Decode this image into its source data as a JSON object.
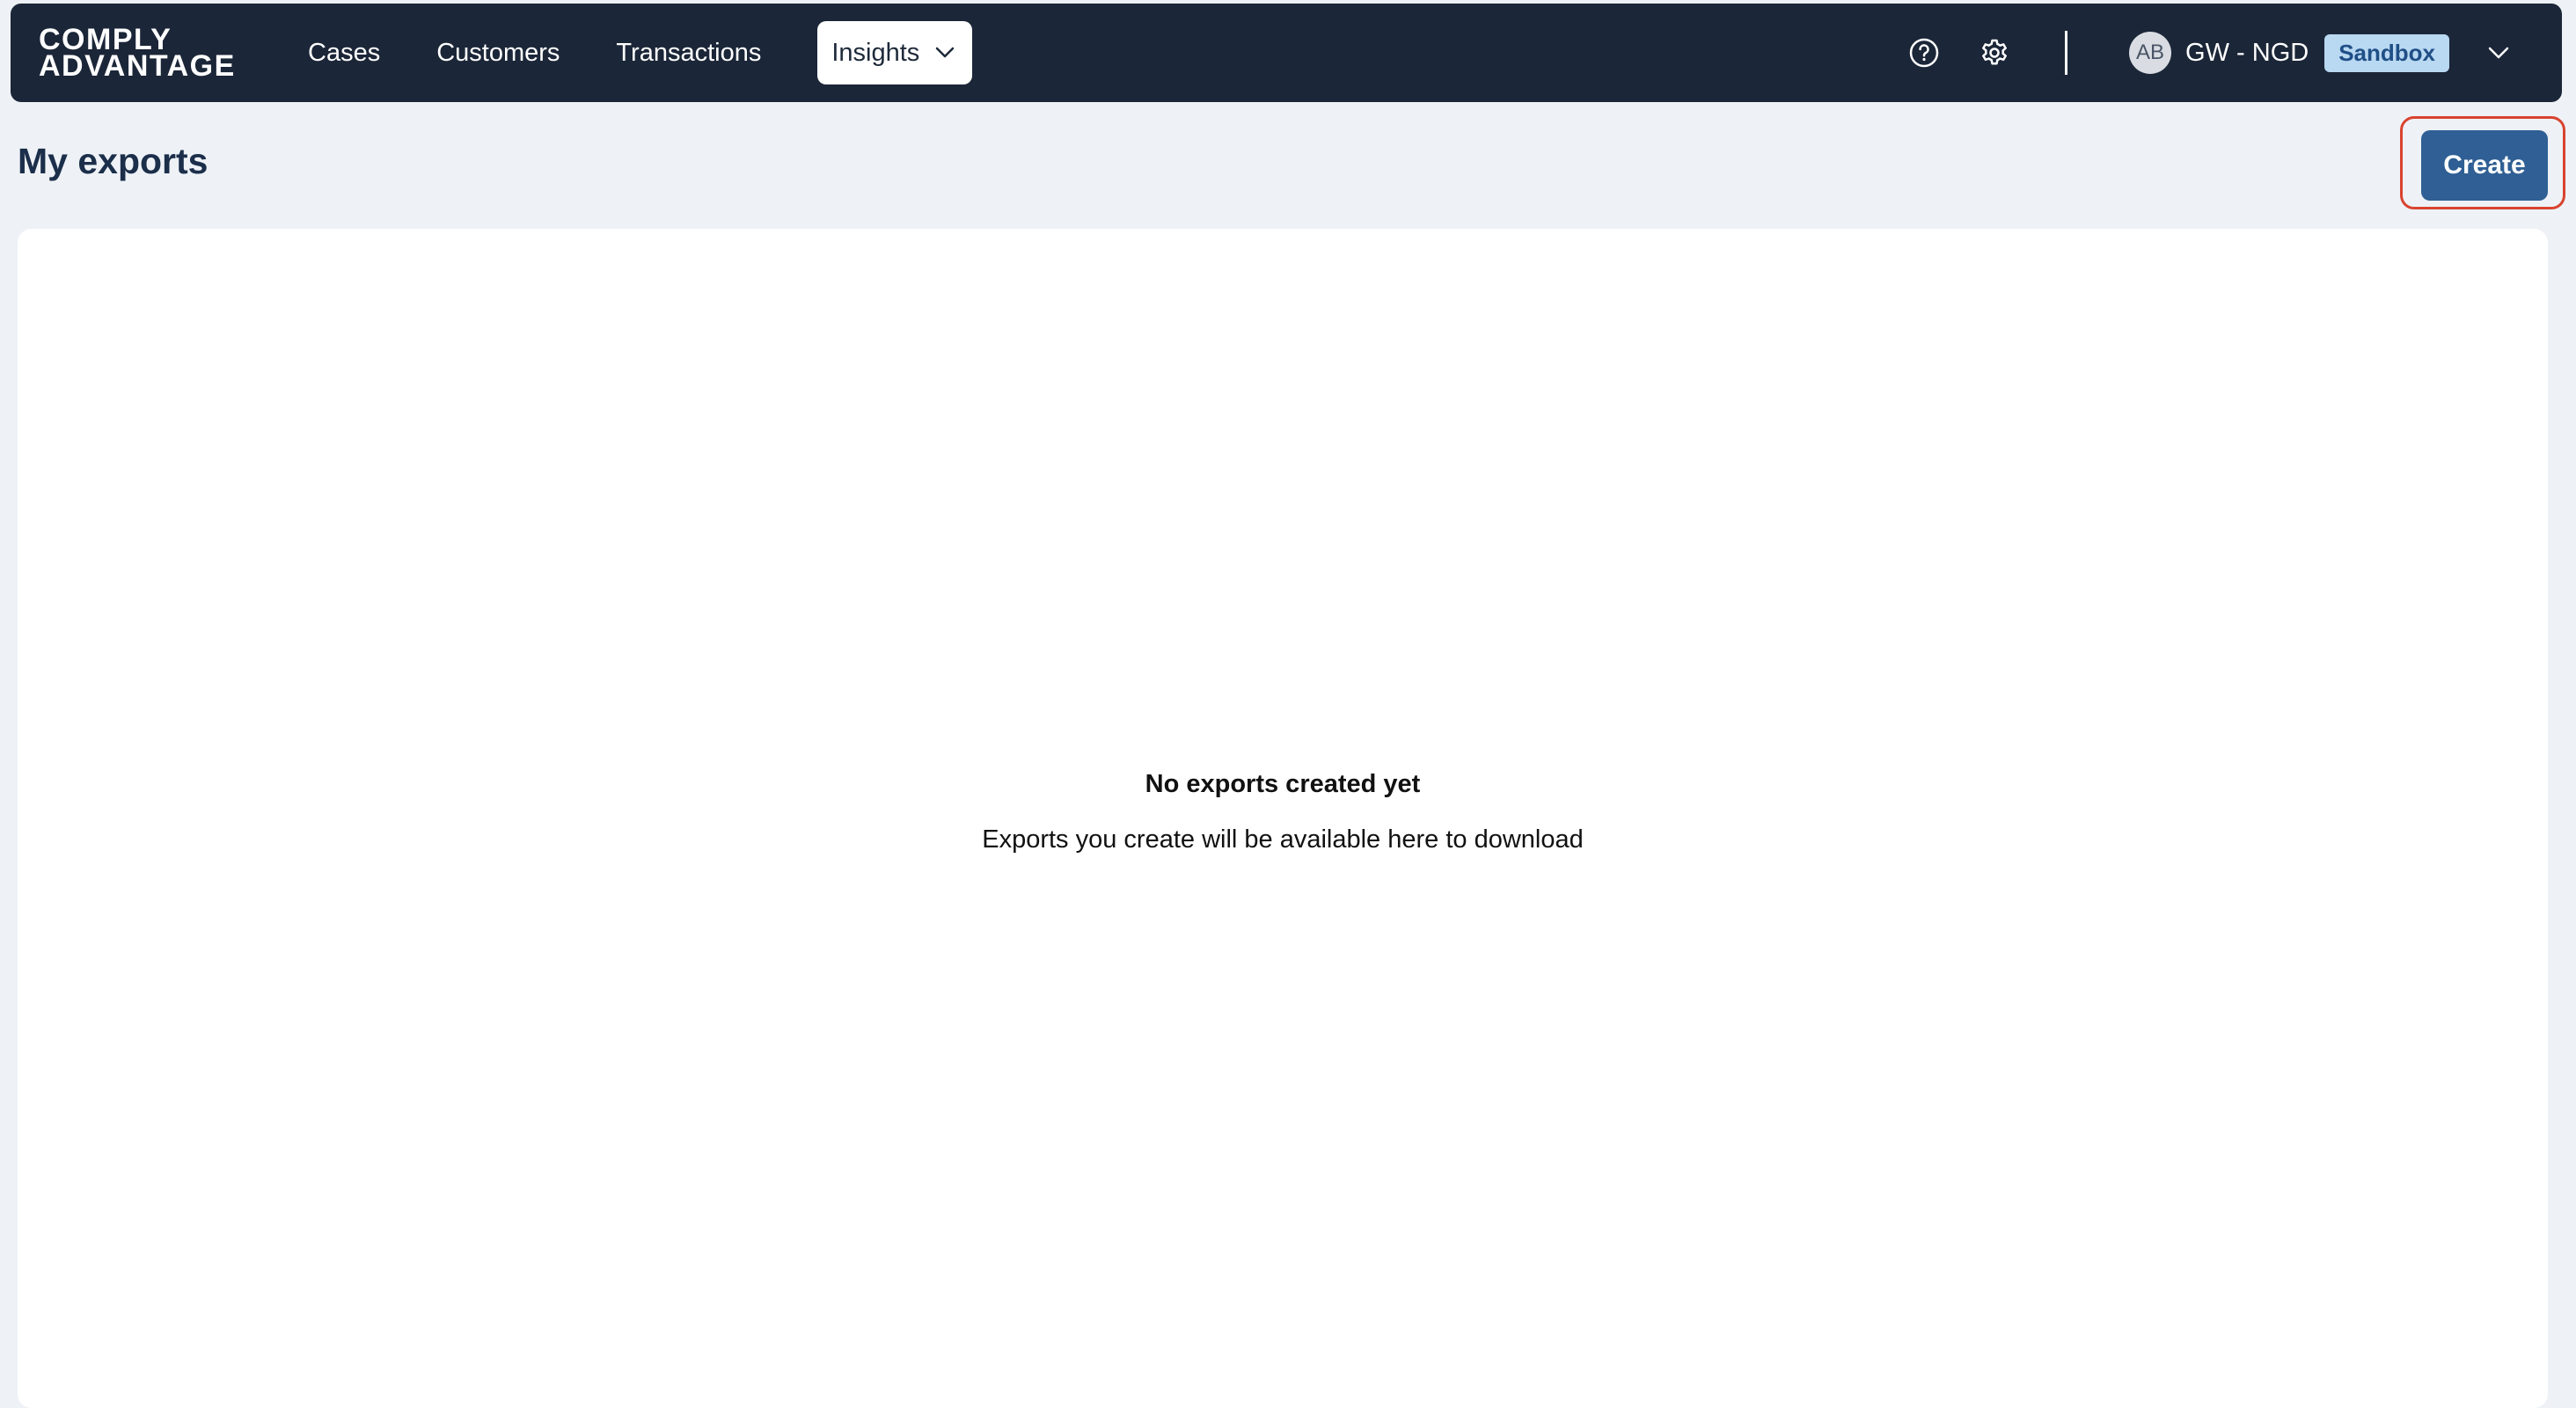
{
  "brand": {
    "line1": "COMPLY",
    "line2": "ADVANTAGE"
  },
  "nav": {
    "items": [
      {
        "label": "Cases"
      },
      {
        "label": "Customers"
      },
      {
        "label": "Transactions"
      }
    ],
    "dropdown": {
      "label": "Insights",
      "icon": "chevron-down-icon"
    }
  },
  "header_right": {
    "help_icon": "question-circle-icon",
    "settings_icon": "gear-icon",
    "avatar_initials": "AB",
    "org_name": "GW - NGD",
    "env_badge": "Sandbox",
    "account_menu_icon": "chevron-down-icon"
  },
  "page": {
    "title": "My exports",
    "create_label": "Create"
  },
  "empty_state": {
    "title": "No exports created yet",
    "subtitle": "Exports you create will be available here to download"
  },
  "colors": {
    "navbar": "#1b2638",
    "accent_button": "#2f5f94",
    "badge_bg": "#b9d8f2",
    "highlight": "#d9432f"
  }
}
